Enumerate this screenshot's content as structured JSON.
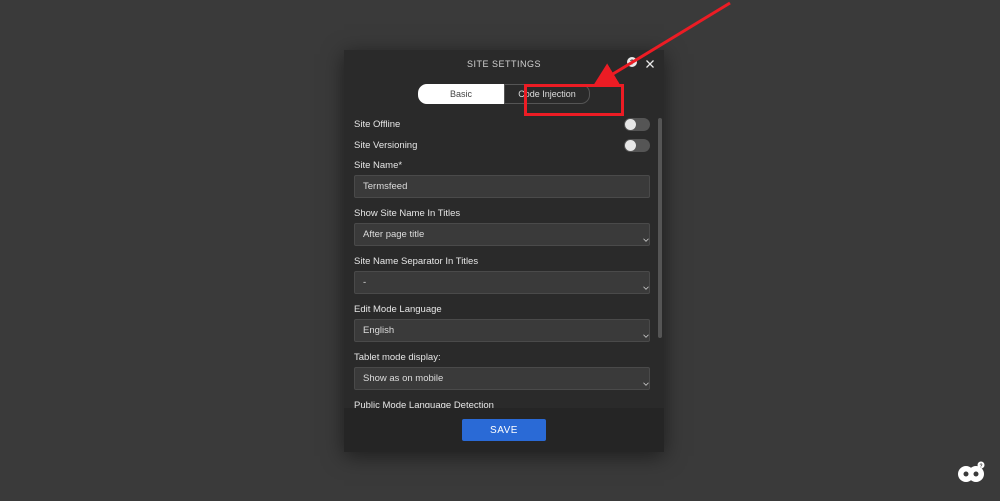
{
  "modal": {
    "title": "SITE SETTINGS",
    "tabs": {
      "basic": "Basic",
      "code_injection": "Code Injection"
    },
    "rows": {
      "site_offline": "Site Offline",
      "site_versioning": "Site Versioning"
    },
    "fields": {
      "site_name_label": "Site Name*",
      "site_name_value": "Termsfeed",
      "show_name_label": "Show Site Name In Titles",
      "show_name_value": "After page title",
      "separator_label": "Site Name Separator In Titles",
      "separator_value": "-",
      "edit_lang_label": "Edit Mode Language",
      "edit_lang_value": "English",
      "tablet_label": "Tablet mode display:",
      "tablet_value": "Show as on mobile",
      "public_lang_label": "Public Mode Language Detection"
    },
    "save": "SAVE"
  },
  "colors": {
    "highlight": "#ec1c24",
    "primary": "#2a6ad6"
  }
}
